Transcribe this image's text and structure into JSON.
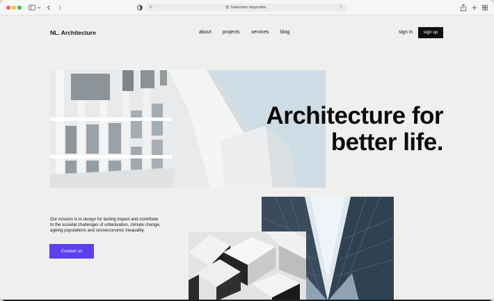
{
  "browser": {
    "address_text": "Traduction disponible"
  },
  "site": {
    "logo": "NL. Architecture",
    "nav": [
      "about",
      "projects",
      "services",
      "blog"
    ],
    "signin": "sign in",
    "signup": "sign up"
  },
  "hero": {
    "headline_line1": "Architecture for",
    "headline_line2": "better life."
  },
  "mission": {
    "text": "Our mission is to design for lasting impact and contribute to the societal challenges of urbanisation, climate change, ageing populations and socioeconomic inequality.",
    "button": "Contact us"
  },
  "colors": {
    "accent": "#5b3ff0",
    "dark": "#0f0f0f"
  }
}
